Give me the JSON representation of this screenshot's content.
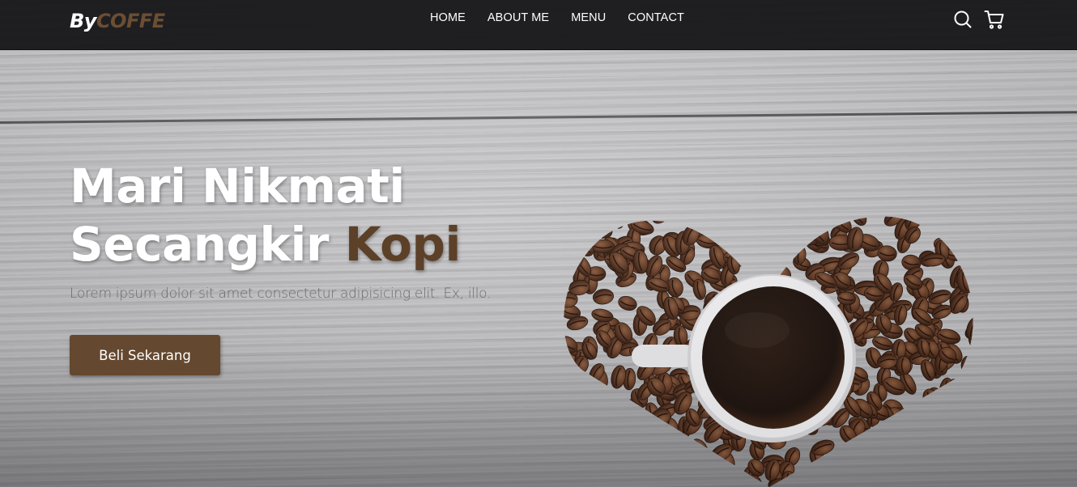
{
  "brand": {
    "part1": "By",
    "part2": "COFFE"
  },
  "nav": {
    "links": [
      {
        "label": "HOME"
      },
      {
        "label": "ABOUT ME"
      },
      {
        "label": "MENU"
      },
      {
        "label": "CONTACT"
      }
    ],
    "icons": [
      "search-icon",
      "cart-icon"
    ]
  },
  "hero": {
    "headline_line1": "Mari Nikmati",
    "headline_line2_a": "Secangkir",
    "headline_line2_b": "Kopi",
    "description": "Lorem ipsum dolor sit amet consectetur adipisicing elit. Ex, illo.",
    "cta_label": "Beli Sekarang"
  },
  "colors": {
    "navbar": "#161618",
    "brand_accent": "#6b4e33",
    "button": "#64482f",
    "headline_accent": "#5c4028",
    "text_white": "#ffffff"
  }
}
